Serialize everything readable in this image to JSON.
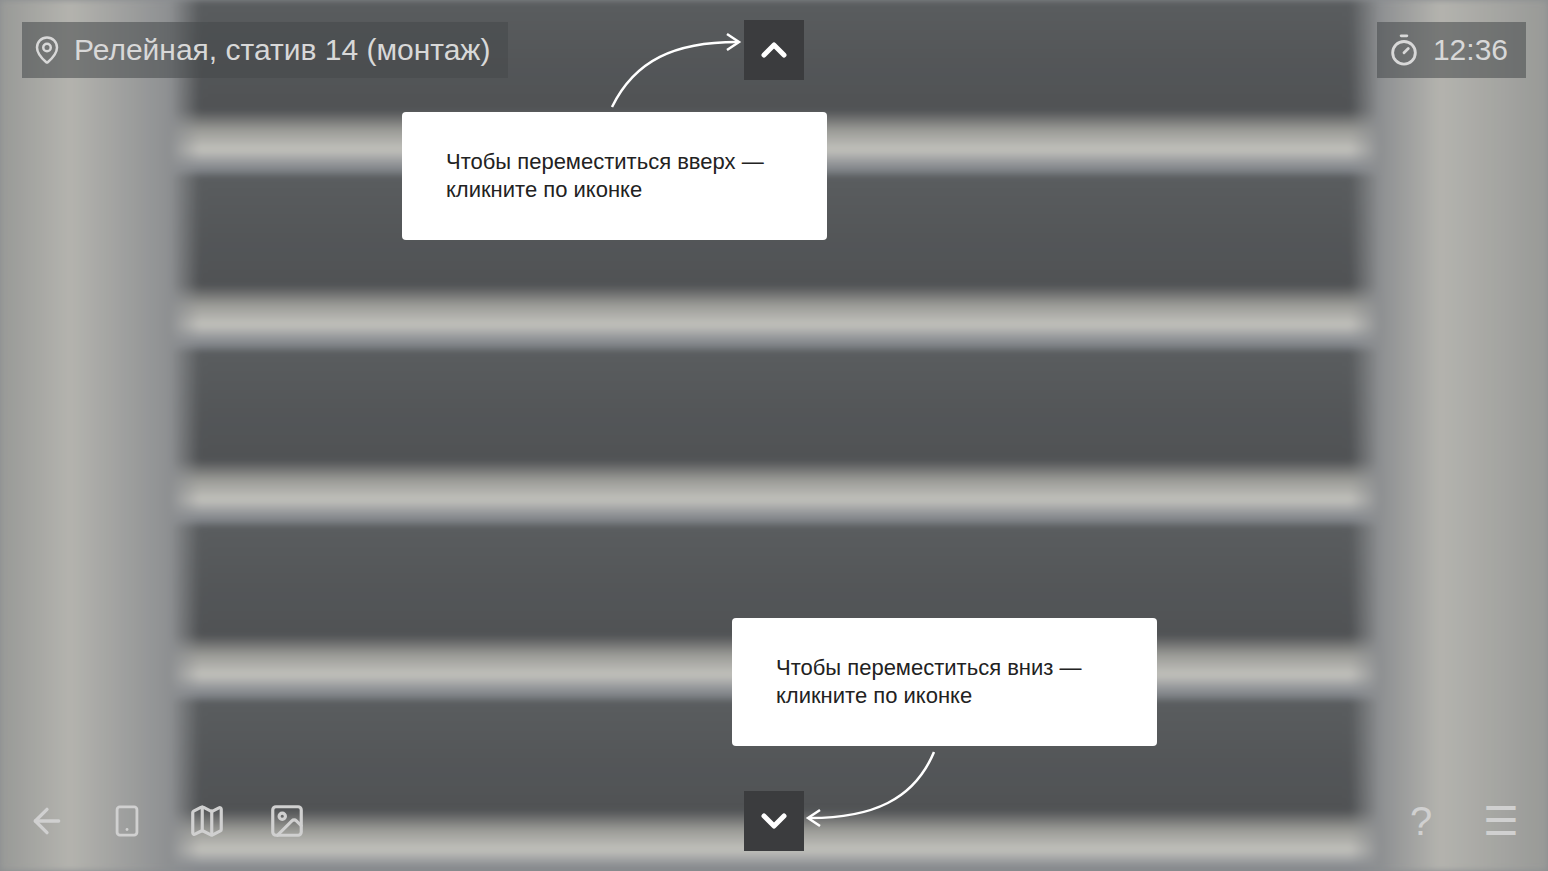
{
  "location": {
    "text": "Релейная, статив 14 (монтаж)"
  },
  "timer": {
    "text": "12:36"
  },
  "hint_up": {
    "lines": [
      "Чтобы переместиться вверх —",
      "кликните по иконке"
    ]
  },
  "hint_down": {
    "lines": [
      "Чтобы переместиться вниз —",
      "кликните по иконке"
    ]
  },
  "toolbar": {
    "help": "?",
    "menu": "☰"
  }
}
